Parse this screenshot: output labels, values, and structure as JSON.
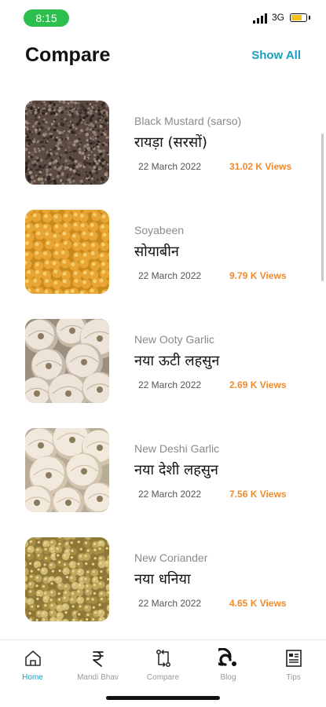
{
  "status_bar": {
    "time": "8:15",
    "network": "3G",
    "battery_level": 0.7
  },
  "header": {
    "title": "Compare",
    "show_all": "Show All"
  },
  "items": [
    {
      "en_name": "Black Mustard (sarso)",
      "hi_name": "रायड़ा (सरसों)",
      "date": "22 March 2022",
      "views": "31.02 K Views",
      "image": "black-mustard-image"
    },
    {
      "en_name": "Soyabeen",
      "hi_name": "सोयाबीन",
      "date": "22 March 2022",
      "views": "9.79 K Views",
      "image": "soyabean-image"
    },
    {
      "en_name": "New Ooty Garlic",
      "hi_name": "नया ऊटी लहसुन",
      "date": "22 March 2022",
      "views": "2.69 K Views",
      "image": "ooty-garlic-image"
    },
    {
      "en_name": "New Deshi Garlic",
      "hi_name": "नया देशी लहसुन",
      "date": "22 March 2022",
      "views": "7.56 K Views",
      "image": "deshi-garlic-image"
    },
    {
      "en_name": "New Coriander",
      "hi_name": "नया धनिया",
      "date": "22 March 2022",
      "views": "4.65 K Views",
      "image": "coriander-image"
    }
  ],
  "nav": [
    {
      "label": "Home",
      "icon": "home-icon",
      "active": true
    },
    {
      "label": "Mandi Bhav",
      "icon": "rupee-icon",
      "active": false
    },
    {
      "label": "Compare",
      "icon": "compare-icon",
      "active": false
    },
    {
      "label": "Blog",
      "icon": "blog-icon",
      "active": false
    },
    {
      "label": "Tips",
      "icon": "tips-icon",
      "active": false
    }
  ],
  "colors": {
    "accent": "#1aa0bd",
    "views": "#f08a2c",
    "status_pill": "#2dbf4e"
  }
}
